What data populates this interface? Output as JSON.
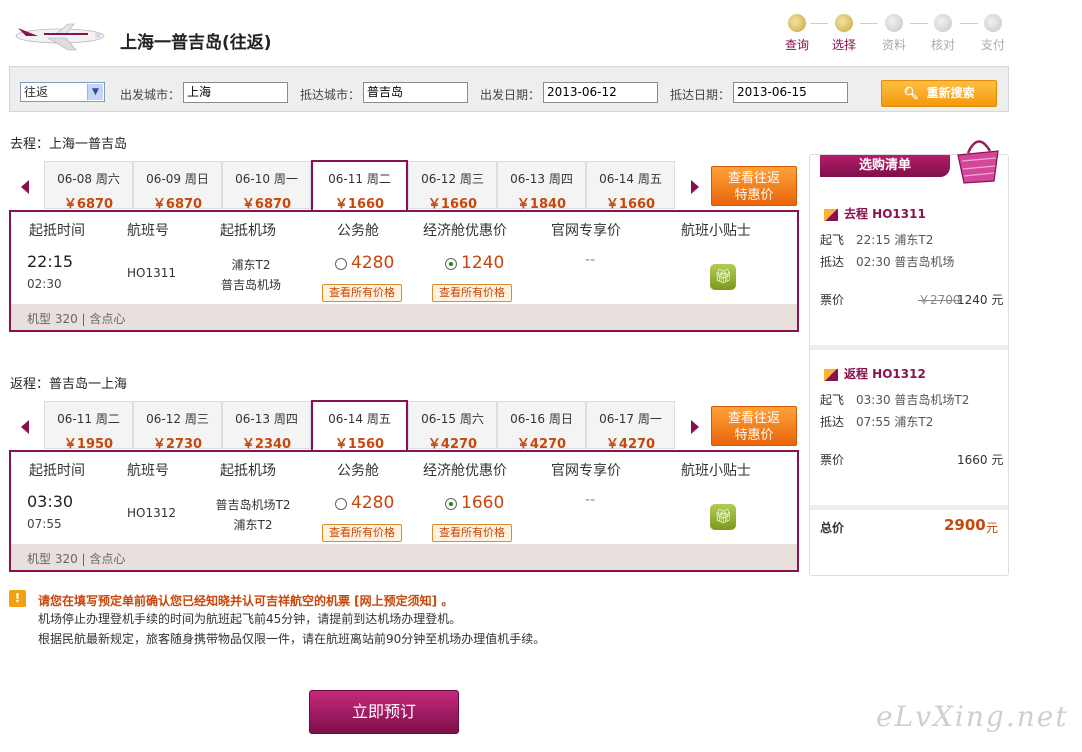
{
  "header": {
    "title": "上海一普吉岛(往返)"
  },
  "steps": [
    {
      "label": "查询",
      "active": true
    },
    {
      "label": "选择",
      "active": true
    },
    {
      "label": "资料",
      "active": false
    },
    {
      "label": "核对",
      "active": false
    },
    {
      "label": "支付",
      "active": false
    }
  ],
  "search": {
    "trip_type": "往返",
    "depart_city_label": "出发城市：",
    "depart_city": "上海",
    "arrive_city_label": "抵达城市：",
    "arrive_city": "普吉岛",
    "depart_date_label": "出发日期：",
    "depart_date": "2013-06-12",
    "arrive_date_label": "抵达日期：",
    "arrive_date": "2013-06-15",
    "button": "重新搜索"
  },
  "outbound": {
    "label": "去程：上海一普吉岛",
    "dates": [
      {
        "date": "06-08 周六",
        "price": "￥6870"
      },
      {
        "date": "06-09 周日",
        "price": "￥6870"
      },
      {
        "date": "06-10 周一",
        "price": "￥6870"
      },
      {
        "date": "06-11 周二",
        "price": "￥1660"
      },
      {
        "date": "06-12 周三",
        "price": "￥1660"
      },
      {
        "date": "06-13 周四",
        "price": "￥1840"
      },
      {
        "date": "06-14 周五",
        "price": "￥1660"
      }
    ],
    "selected_index": 3,
    "promo": "查看往返\n特惠价",
    "headers": [
      "起抵时间",
      "航班号",
      "起抵机场",
      "公务舱",
      "经济舱优惠价",
      "官网专享价",
      "航班小贴士"
    ],
    "flight": {
      "dep_time": "22:15",
      "arr_time": "02:30",
      "number": "HO1311",
      "dep_airport": "浦东T2",
      "arr_airport": "普吉岛机场",
      "business_price": "4280",
      "economy_price": "1240",
      "all_prices": "查看所有价格",
      "web_price": "--"
    },
    "footer": "机型 320 | 含点心"
  },
  "return": {
    "label": "返程：普吉岛一上海",
    "dates": [
      {
        "date": "06-11 周二",
        "price": "￥1950"
      },
      {
        "date": "06-12 周三",
        "price": "￥2730"
      },
      {
        "date": "06-13 周四",
        "price": "￥2340"
      },
      {
        "date": "06-14 周五",
        "price": "￥1560"
      },
      {
        "date": "06-15 周六",
        "price": "￥4270"
      },
      {
        "date": "06-16 周日",
        "price": "￥4270"
      },
      {
        "date": "06-17 周一",
        "price": "￥4270"
      }
    ],
    "selected_index": 3,
    "promo": "查看往返\n特惠价",
    "headers": [
      "起抵时间",
      "航班号",
      "起抵机场",
      "公务舱",
      "经济舱优惠价",
      "官网专享价",
      "航班小贴士"
    ],
    "flight": {
      "dep_time": "03:30",
      "arr_time": "07:55",
      "number": "HO1312",
      "dep_airport": "普吉岛机场T2",
      "arr_airport": "浦东T2",
      "business_price": "4280",
      "economy_price": "1660",
      "all_prices": "查看所有价格",
      "web_price": "--"
    },
    "footer": "机型 320 | 含点心"
  },
  "cart": {
    "title": "选购清单",
    "out": {
      "head": "去程 HO1311",
      "dep_label": "起飞",
      "dep": "22:15  浦东T2",
      "arr_label": "抵达",
      "arr": "02:30  普吉岛机场",
      "price_label": "票价",
      "old_price": "￥2700",
      "price": "1240 元"
    },
    "ret": {
      "head": "返程 HO1312",
      "dep_label": "起飞",
      "dep": "03:30  普吉岛机场T2",
      "arr_label": "抵达",
      "arr": "07:55  浦东T2",
      "price_label": "票价",
      "price": "1660 元"
    },
    "total_label": "总价",
    "total": "2900",
    "total_unit": "元"
  },
  "notice": {
    "main": "请您在填写预定单前确认您已经知晓并认可吉祥航空的机票 [网上预定须知] 。",
    "line1": "机场停止办理登机手续的时间为航班起飞前45分钟，请提前到达机场办理登机。",
    "line2": "根据民航最新规定，旅客随身携带物品仅限一件，请在航班离站前90分钟至机场办理值机手续。"
  },
  "book_button": "立即预订",
  "watermark": "eLvXing.net",
  "colors": {
    "brand": "#8a1150",
    "accent": "#f29a0c",
    "price": "#c8470b"
  }
}
